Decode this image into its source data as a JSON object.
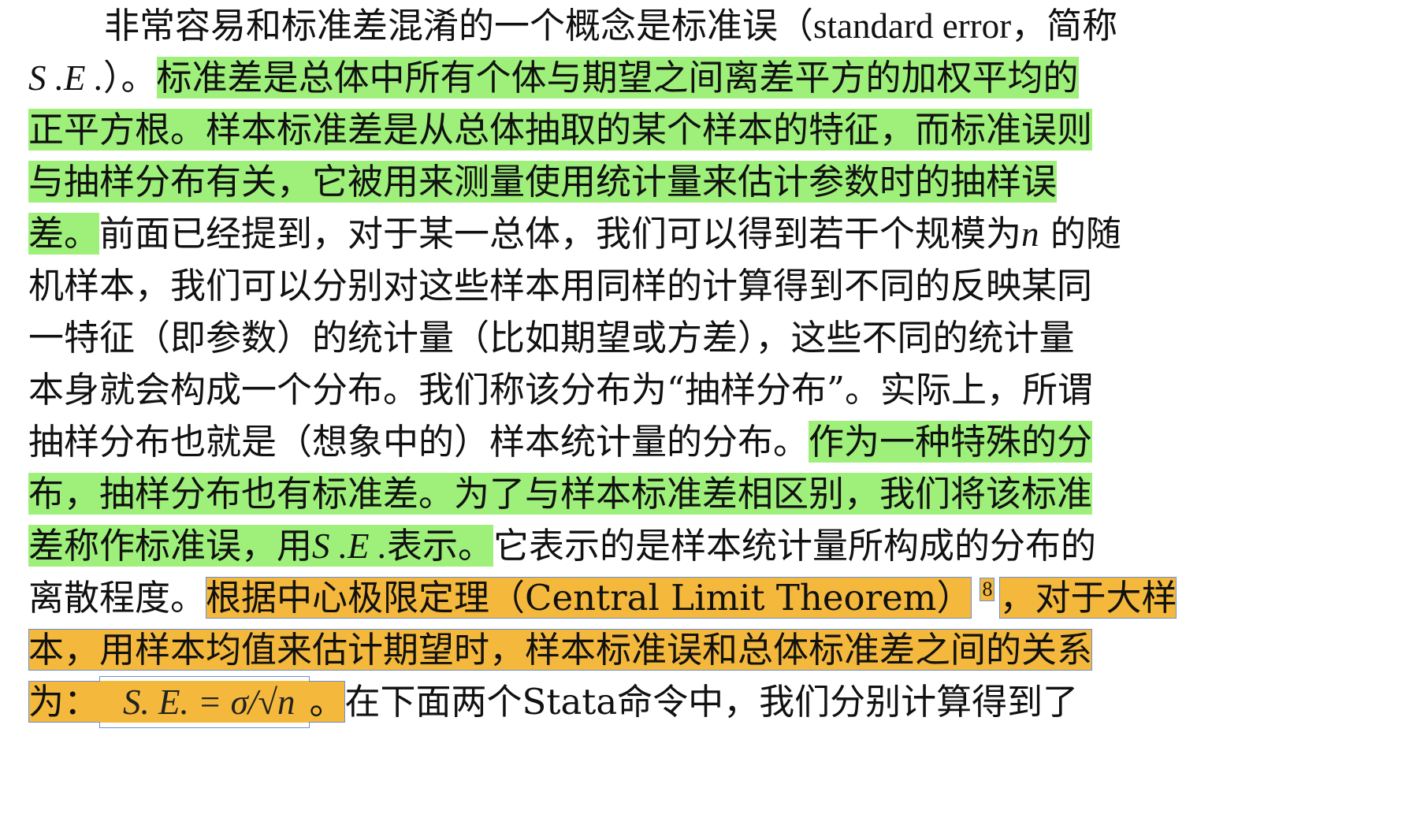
{
  "paragraph": {
    "l1_a": "非常容易和标准差混淆的一个概念是标准误（",
    "l1_b": "standard error",
    "l1_c": "，简称",
    "l2_a": "S .E .",
    "l2_b": "）。",
    "l2_hl": "标准差是总体中所有个体与期望之间离差平方的加权平均的",
    "l3_hl": "正平方根。样本标准差是从总体抽取的某个样本的特征，而标准误则",
    "l4_hl": "与抽样分布有关，它被用来测量使用统计量来估计参数时的抽样误",
    "l5_hl": "差。",
    "l5_a": "前面已经提到，对于某一总体，我们可以得到若干个规模为",
    "l5_n": "n",
    "l5_b": " 的随",
    "l6": "机样本，我们可以分别对这些样本用同样的计算得到不同的反映某同",
    "l7": "一特征（即参数）的统计量（比如期望或方差），这些不同的统计量",
    "l8": "本身就会构成一个分布。我们称该分布为“抽样分布”。实际上，所谓",
    "l9_a": "抽样分布也就是（想象中的）样本统计量的分布。",
    "l9_hl": "作为一种特殊的分",
    "l10_hl": "布，抽样分布也有标准差。为了与样本标准差相区别，我们将该标准",
    "l11_hl_a": "差称作标准误，用",
    "l11_hl_se": "S .E .",
    "l11_hl_b": "表示。",
    "l11_a": "它表示的是样本统计量所构成的分布的",
    "l12_a": "离散程度。",
    "l12_hl": "根据中心极限定理（Central Limit Theorem）",
    "l12_cite": "8",
    "l12_hl2": "，对于大样",
    "l13_hl": "本，用样本均值来估计期望时，样本标准误和总体标准差之间的关系",
    "l14_hl_a": "为：",
    "l14_formula": "S. E.  = σ/√n",
    "l14_hl_b": "。",
    "l14_a": "在下面两个Stata命令中，我们分别计算得到了"
  },
  "colors": {
    "highlight_green": "#9ef07a",
    "highlight_orange": "#f4b93c",
    "highlight_border": "#6a8fd6"
  }
}
